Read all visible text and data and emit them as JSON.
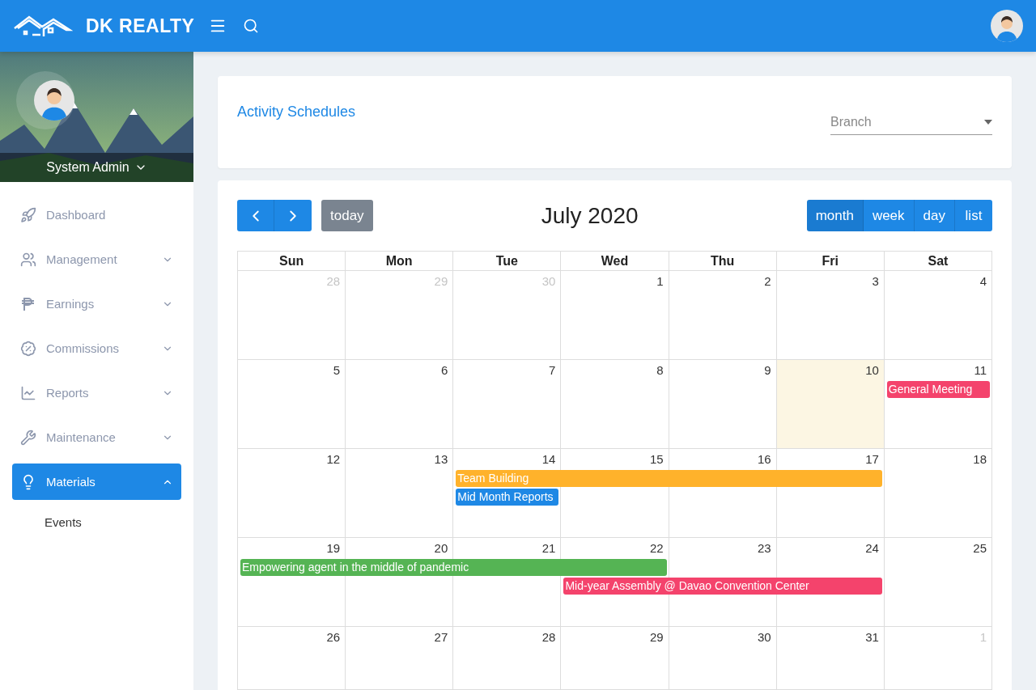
{
  "topbar": {
    "brand": "DK REALTY"
  },
  "sidebar": {
    "user": "System Admin",
    "items": [
      {
        "label": "Dashboard",
        "selected": false
      },
      {
        "label": "Management",
        "selected": false,
        "expanded": false
      },
      {
        "label": "Earnings",
        "selected": false,
        "expanded": false
      },
      {
        "label": "Commissions",
        "selected": false,
        "expanded": false
      },
      {
        "label": "Reports",
        "selected": false,
        "expanded": false
      },
      {
        "label": "Maintenance",
        "selected": false,
        "expanded": false
      },
      {
        "label": "Materials",
        "selected": true,
        "expanded": true,
        "children": [
          {
            "label": "Events"
          }
        ]
      }
    ]
  },
  "header_card": {
    "title": "Activity Schedules",
    "branch": {
      "placeholder": "Branch"
    }
  },
  "calendar": {
    "title": "July 2020",
    "today_button": "today",
    "views": [
      {
        "label": "month",
        "selected": true
      },
      {
        "label": "week",
        "selected": false
      },
      {
        "label": "day",
        "selected": false
      },
      {
        "label": "list",
        "selected": false
      }
    ],
    "weekdays": [
      "Sun",
      "Mon",
      "Tue",
      "Wed",
      "Thu",
      "Fri",
      "Sat"
    ],
    "weeks": [
      {
        "days": [
          {
            "n": "28",
            "other_month": true,
            "today": false
          },
          {
            "n": "29",
            "other_month": true,
            "today": false
          },
          {
            "n": "30",
            "other_month": true,
            "today": false
          },
          {
            "n": "1",
            "other_month": false,
            "today": false
          },
          {
            "n": "2",
            "other_month": false,
            "today": false
          },
          {
            "n": "3",
            "other_month": false,
            "today": false
          },
          {
            "n": "4",
            "other_month": false,
            "today": false
          }
        ]
      },
      {
        "days": [
          {
            "n": "5",
            "other_month": false,
            "today": false
          },
          {
            "n": "6",
            "other_month": false,
            "today": false
          },
          {
            "n": "7",
            "other_month": false,
            "today": false
          },
          {
            "n": "8",
            "other_month": false,
            "today": false
          },
          {
            "n": "9",
            "other_month": false,
            "today": false
          },
          {
            "n": "10",
            "other_month": false,
            "today": true
          },
          {
            "n": "11",
            "other_month": false,
            "today": false
          }
        ],
        "events": [
          {
            "title": "General Meeting",
            "color": "#f4436c"
          }
        ]
      },
      {
        "days": [
          {
            "n": "12",
            "other_month": false,
            "today": false
          },
          {
            "n": "13",
            "other_month": false,
            "today": false
          },
          {
            "n": "14",
            "other_month": false,
            "today": false
          },
          {
            "n": "15",
            "other_month": false,
            "today": false
          },
          {
            "n": "16",
            "other_month": false,
            "today": false
          },
          {
            "n": "17",
            "other_month": false,
            "today": false
          },
          {
            "n": "18",
            "other_month": false,
            "today": false
          }
        ],
        "events": [
          {
            "title": "Team Building",
            "color": "#ffb22b"
          },
          {
            "title": "Mid Month Reports",
            "color": "#1e88e5"
          }
        ]
      },
      {
        "days": [
          {
            "n": "19",
            "other_month": false,
            "today": false
          },
          {
            "n": "20",
            "other_month": false,
            "today": false
          },
          {
            "n": "21",
            "other_month": false,
            "today": false
          },
          {
            "n": "22",
            "other_month": false,
            "today": false
          },
          {
            "n": "23",
            "other_month": false,
            "today": false
          },
          {
            "n": "24",
            "other_month": false,
            "today": false
          },
          {
            "n": "25",
            "other_month": false,
            "today": false
          }
        ],
        "events": [
          {
            "title": "Empowering agent in the middle of pandemic",
            "color": "#55b454"
          },
          {
            "title": "Mid-year Assembly @ Davao Convention Center",
            "color": "#f4436c"
          }
        ]
      },
      {
        "days": [
          {
            "n": "26",
            "other_month": false,
            "today": false
          },
          {
            "n": "27",
            "other_month": false,
            "today": false
          },
          {
            "n": "28",
            "other_month": false,
            "today": false
          },
          {
            "n": "29",
            "other_month": false,
            "today": false
          },
          {
            "n": "30",
            "other_month": false,
            "today": false
          },
          {
            "n": "31",
            "other_month": false,
            "today": false
          },
          {
            "n": "1",
            "other_month": true,
            "today": false
          }
        ]
      }
    ]
  }
}
